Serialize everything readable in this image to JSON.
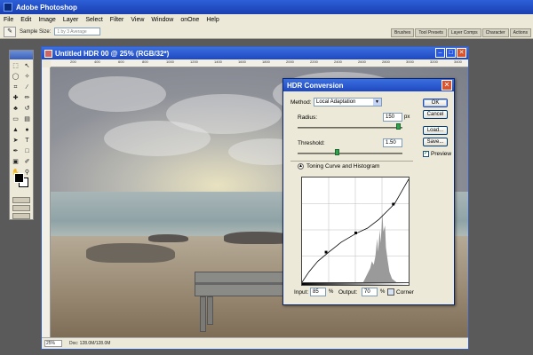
{
  "app": {
    "title": "Adobe Photoshop"
  },
  "menu": [
    "File",
    "Edit",
    "Image",
    "Layer",
    "Select",
    "Filter",
    "View",
    "Window",
    "onOne",
    "Help"
  ],
  "options_bar": {
    "sample_size_label": "Sample Size:",
    "sample_size_value": "1 by 3 Average"
  },
  "palette_tabs": [
    "Brushes",
    "Tool Presets",
    "Layer Comps",
    "Character",
    "Actions"
  ],
  "document": {
    "title": "Untitled HDR 00 @ 25% (RGB/32*)",
    "ruler_ticks": [
      "200",
      "400",
      "600",
      "800",
      "1000",
      "1200",
      "1400",
      "1600",
      "1800",
      "2000",
      "2200",
      "2400",
      "2600",
      "2800",
      "3000",
      "3200",
      "3400"
    ],
    "status_zoom": "25%",
    "status_doc": "Doc: 128.0M/128.0M"
  },
  "dialog": {
    "title": "HDR Conversion",
    "method_label": "Method:",
    "method_value": "Local Adaptation",
    "radius_label": "Radius:",
    "radius_value": "150",
    "radius_unit": "px",
    "threshold_label": "Threshold:",
    "threshold_value": "1.50",
    "toning_label": "Toning Curve and Histogram",
    "input_label": "Input:",
    "input_value": "85",
    "input_unit": "%",
    "output_label": "Output:",
    "output_value": "70",
    "output_unit": "%",
    "corner_label": "Corner",
    "buttons": {
      "ok": "OK",
      "cancel": "Cancel",
      "load": "Load...",
      "save": "Save..."
    },
    "preview_label": "Preview",
    "preview_checked": true
  }
}
